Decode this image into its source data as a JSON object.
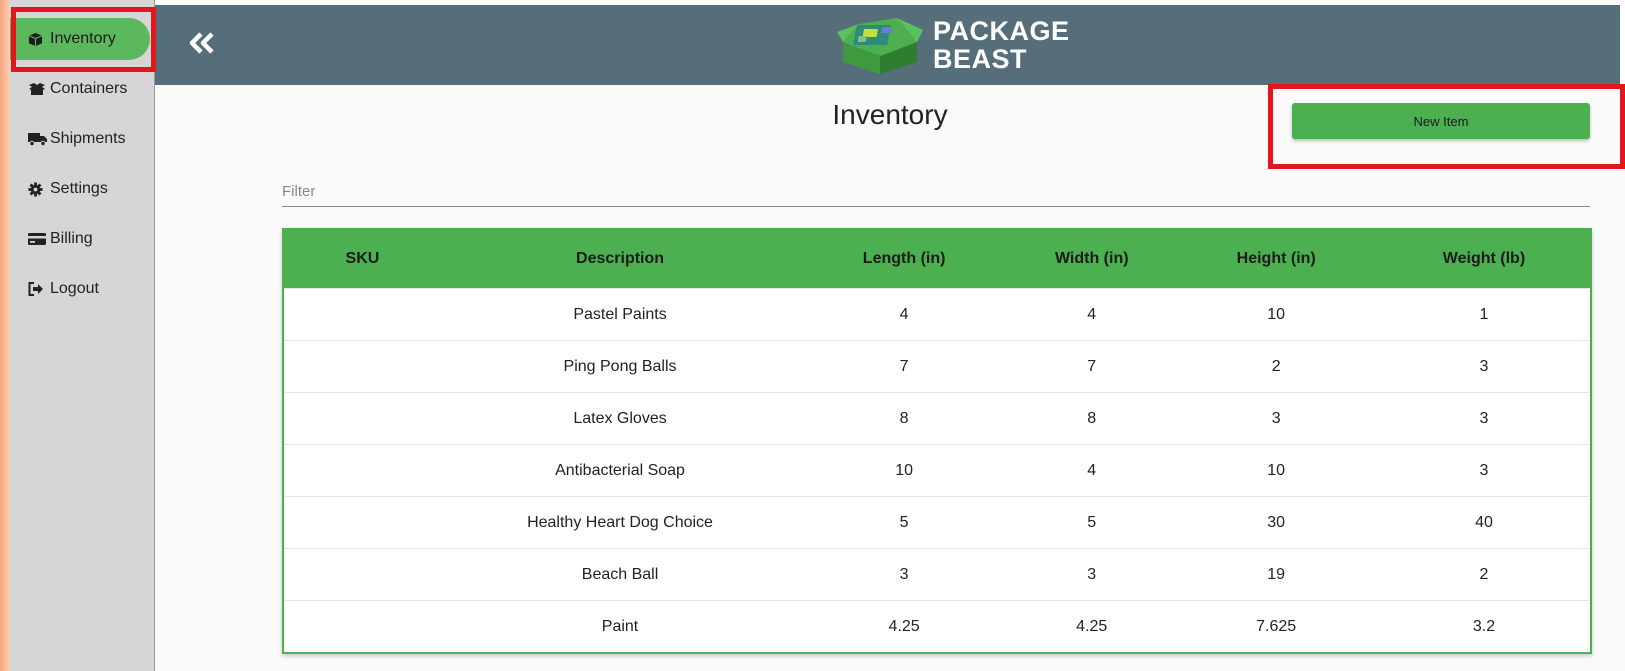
{
  "sidebar": {
    "items": [
      {
        "label": "Inventory",
        "icon": "box-icon",
        "active": true
      },
      {
        "label": "Containers",
        "icon": "boxes-icon"
      },
      {
        "label": "Shipments",
        "icon": "truck-icon"
      },
      {
        "label": "Settings",
        "icon": "gear-icon"
      },
      {
        "label": "Billing",
        "icon": "credit-card-icon"
      },
      {
        "label": "Logout",
        "icon": "logout-icon"
      }
    ]
  },
  "header": {
    "collapse_icon": "double-chevron-left-icon",
    "logo": {
      "line1": "PACKAGE",
      "line2": "BEAST",
      "icon": "package-box-icon"
    }
  },
  "main": {
    "title": "Inventory",
    "new_item_label": "New Item",
    "filter": {
      "placeholder": "Filter",
      "value": ""
    }
  },
  "table": {
    "columns": [
      "SKU",
      "Description",
      "Length (in)",
      "Width (in)",
      "Height (in)",
      "Weight (lb)"
    ],
    "rows": [
      [
        "",
        "Pastel Paints",
        "4",
        "4",
        "10",
        "1"
      ],
      [
        "",
        "Ping Pong Balls",
        "7",
        "7",
        "2",
        "3"
      ],
      [
        "",
        "Latex Gloves",
        "8",
        "8",
        "3",
        "3"
      ],
      [
        "",
        "Antibacterial Soap",
        "10",
        "4",
        "10",
        "3"
      ],
      [
        "",
        "Healthy Heart Dog Choice",
        "5",
        "5",
        "30",
        "40"
      ],
      [
        "",
        "Beach Ball",
        "3",
        "3",
        "19",
        "2"
      ],
      [
        "",
        "Paint",
        "4.25",
        "4.25",
        "7.625",
        "3.2"
      ]
    ]
  },
  "colors": {
    "accent_green": "#4caf50",
    "header_bg": "#566e79",
    "sidebar_bg": "#d6d6d6",
    "highlight_red": "#e3151d"
  }
}
